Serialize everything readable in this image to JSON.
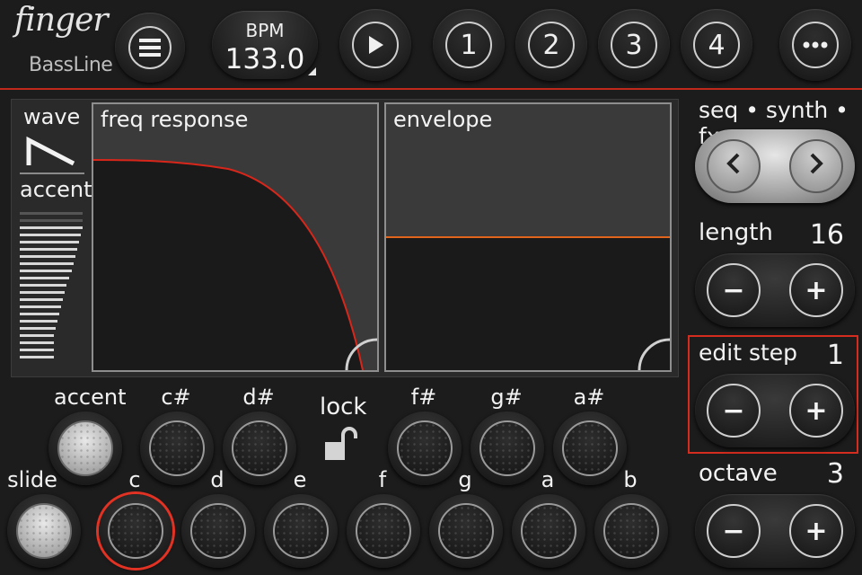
{
  "app": {
    "logo": "finger",
    "subtitle": "BassLine"
  },
  "header": {
    "menu_icon": "menu-icon",
    "bpm": {
      "label": "BPM",
      "value": "133.0"
    },
    "play_icon": "play-icon",
    "patterns": [
      "1",
      "2",
      "3",
      "4"
    ],
    "more_icon": "more-icon"
  },
  "display": {
    "wave_label": "wave",
    "accent_label": "accent",
    "freq_title": "freq response",
    "env_title": "envelope"
  },
  "right": {
    "page_nav_label": "seq • synth • fx",
    "length": {
      "label": "length",
      "value": "16"
    },
    "edit_step": {
      "label": "edit step",
      "value": "1"
    },
    "octave": {
      "label": "octave",
      "value": "3"
    },
    "minus": "−",
    "plus": "+"
  },
  "keys": {
    "accent_label": "accent",
    "slide_label": "slide",
    "lock_label": "lock",
    "sharps": [
      "c#",
      "d#",
      "f#",
      "g#",
      "a#"
    ],
    "naturals": [
      "c",
      "d",
      "e",
      "f",
      "g",
      "a",
      "b"
    ],
    "active_note": "c"
  },
  "colors": {
    "accent_red": "#d42c1e",
    "envelope_line": "#e0641c",
    "freq_curve": "#d8261a"
  }
}
